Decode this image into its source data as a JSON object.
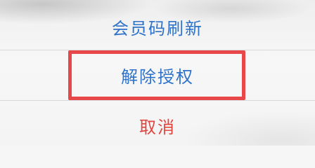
{
  "action_sheet": {
    "refresh_code_label": "会员码刷新",
    "revoke_authorization_label": "解除授权",
    "cancel_label": "取消"
  },
  "colors": {
    "action_text": "#2f73c9",
    "cancel_text": "#e0463f",
    "highlight_border": "#e8474a"
  }
}
